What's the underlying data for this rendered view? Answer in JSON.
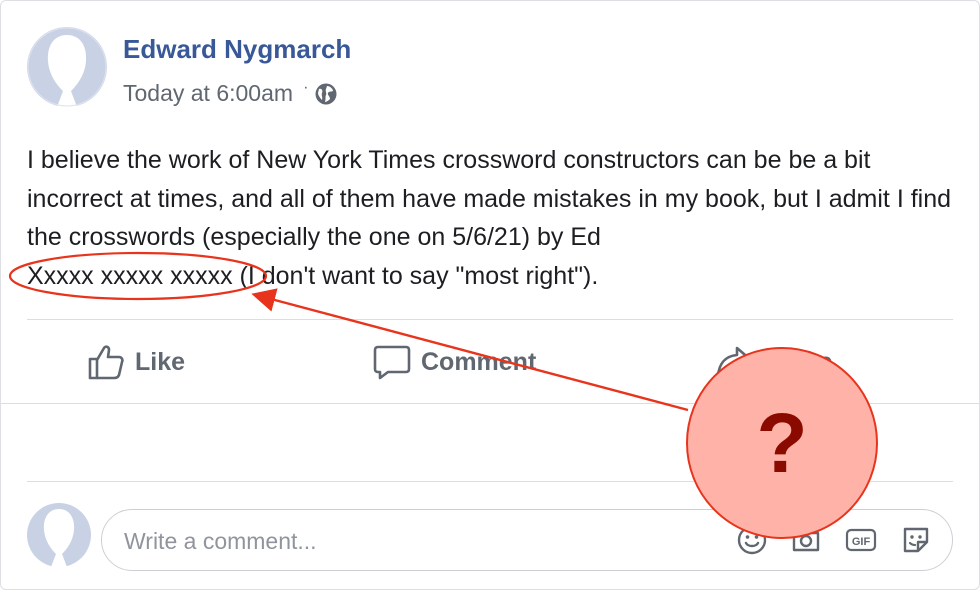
{
  "post": {
    "author": "Edward Nygmarch",
    "timestamp": "Today at 6:00am",
    "separator": "·",
    "privacy_icon": "globe-icon",
    "text_main": "I believe the work of New York Times crossword constructors can be be a bit incorrect at times, and all of them have made mistakes in my book, but I admit I find the crosswords (especially the one on 5/6/21) by Ed",
    "text_redacted": "Xxxxx xxxxx xxxxx",
    "text_tail": "(I don't want to say \"most right\")."
  },
  "actions": {
    "like_label": "Like",
    "comment_label": "Comment",
    "share_label": "Share"
  },
  "composer": {
    "placeholder": "Write a comment...",
    "icons": [
      "emoji-icon",
      "camera-icon",
      "gif-icon",
      "sticker-icon"
    ],
    "gif_text": "GIF"
  },
  "annotation": {
    "question_mark": "?",
    "accent_color": "#e8341c",
    "badge_fill": "#ffb3a8"
  },
  "colors": {
    "name_link": "#385898",
    "meta_text": "#616770",
    "body_text": "#1c1e21",
    "action_text": "#606770"
  }
}
